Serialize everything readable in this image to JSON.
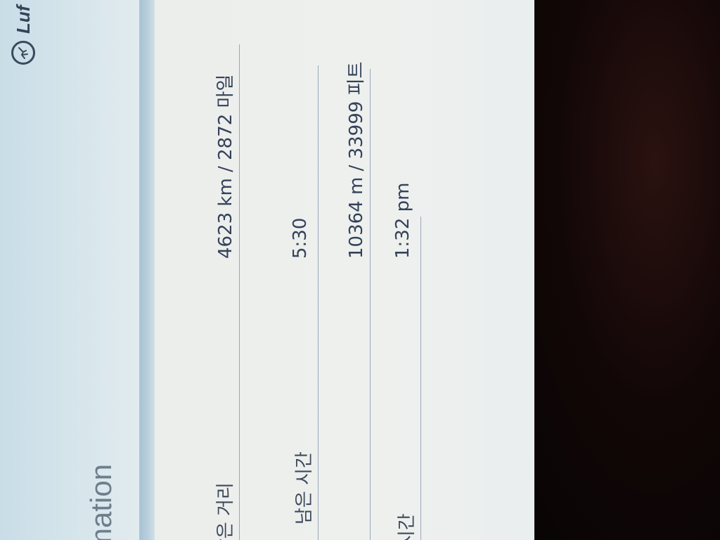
{
  "header": {
    "title": "mation",
    "brand": "Luf"
  },
  "rows": [
    {
      "label": "남은 거리",
      "value": "4623 km / 2872 마일"
    },
    {
      "label": "남은 시간",
      "value": "5:30"
    },
    {
      "label": "",
      "value": "10364 m / 33999 피트"
    },
    {
      "label": "시간",
      "value": "1:32 pm"
    }
  ]
}
